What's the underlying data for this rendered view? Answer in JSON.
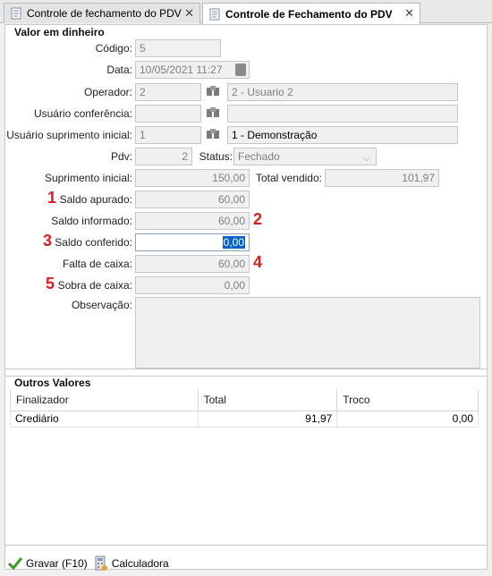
{
  "tabs": [
    {
      "label": "Controle de fechamento do PDV",
      "active": false
    },
    {
      "label": "Controle de Fechamento do PDV",
      "active": true
    }
  ],
  "cash": {
    "title": "Valor em dinheiro",
    "codigo_label": "Código:",
    "codigo": "5",
    "data_label": "Data:",
    "data": "10/05/2021 11:27",
    "operador_label": "Operador:",
    "operador_id": "2",
    "operador_nome": "2 - Usuario 2",
    "conferencia_label": "Usuário conferência:",
    "conferencia_id": "",
    "conferencia_nome": "",
    "suprimento_user_label": "Usuário suprimento inicial:",
    "suprimento_user_id": "1",
    "suprimento_user_nome": "1 - Demonstração",
    "pdv_label": "Pdv:",
    "pdv": "2",
    "status_label": "Status:",
    "status": "Fechado",
    "suprimento_inicial_label": "Suprimento inicial:",
    "suprimento_inicial": "150,00",
    "total_vendido_label": "Total vendido:",
    "total_vendido": "101,97",
    "saldo_apurado_label": "Saldo apurado:",
    "saldo_apurado": "60,00",
    "saldo_informado_label": "Saldo informado:",
    "saldo_informado": "60,00",
    "saldo_conferido_label": "Saldo conferido:",
    "saldo_conferido": "0,00",
    "falta_label": "Falta de caixa:",
    "falta": "60,00",
    "sobra_label": "Sobra de caixa:",
    "sobra": "0,00",
    "observacao_label": "Observação:",
    "observacao": ""
  },
  "markers": [
    "1",
    "2",
    "3",
    "4",
    "5"
  ],
  "outros": {
    "title": "Outros Valores",
    "columns": [
      "Finalizador",
      "Total",
      "Troco"
    ],
    "rows": [
      {
        "finalizador": "Crediário",
        "total": "91,97",
        "troco": "0,00"
      }
    ]
  },
  "footer": {
    "gravar": "Gravar (F10)",
    "calculadora": "Calculadora"
  },
  "colors": {
    "marker": "#d42020",
    "selection": "#0a63c9"
  }
}
